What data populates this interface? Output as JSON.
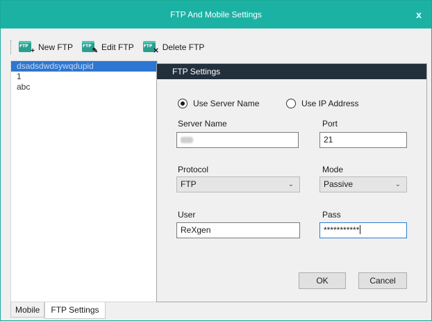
{
  "window": {
    "title": "FTP And Mobile Settings",
    "close_glyph": "x"
  },
  "toolbar": {
    "new_label": "New FTP",
    "edit_label": "Edit FTP",
    "delete_label": "Delete FTP",
    "new_icon": "ftp-add-icon",
    "edit_icon": "ftp-edit-icon",
    "delete_icon": "ftp-delete-icon"
  },
  "list": {
    "items": [
      {
        "label": "dsadsdwdsywqdupid",
        "selected": true
      },
      {
        "label": "1",
        "selected": false
      },
      {
        "label": "abc",
        "selected": false
      }
    ]
  },
  "settings": {
    "header": "FTP Settings",
    "radio_server_name": "Use Server Name",
    "radio_ip": "Use IP Address",
    "selected_mode": "Use Server Name",
    "server_name_label": "Server Name",
    "server_name_value": "",
    "port_label": "Port",
    "port_value": "21",
    "protocol_label": "Protocol",
    "protocol_value": "FTP",
    "mode_label": "Mode",
    "mode_value": "Passive",
    "user_label": "User",
    "user_value": "ReXgen",
    "pass_label": "Pass",
    "pass_value": "***********",
    "ok_label": "OK",
    "cancel_label": "Cancel"
  },
  "tabs": [
    {
      "label": "Mobile",
      "active": false
    },
    {
      "label": "FTP Settings",
      "active": true
    }
  ],
  "colors": {
    "titlebar": "#1bb2a4",
    "panel_header": "#22303c",
    "selection": "#2d76d2",
    "focus_border": "#2a7ad2"
  }
}
